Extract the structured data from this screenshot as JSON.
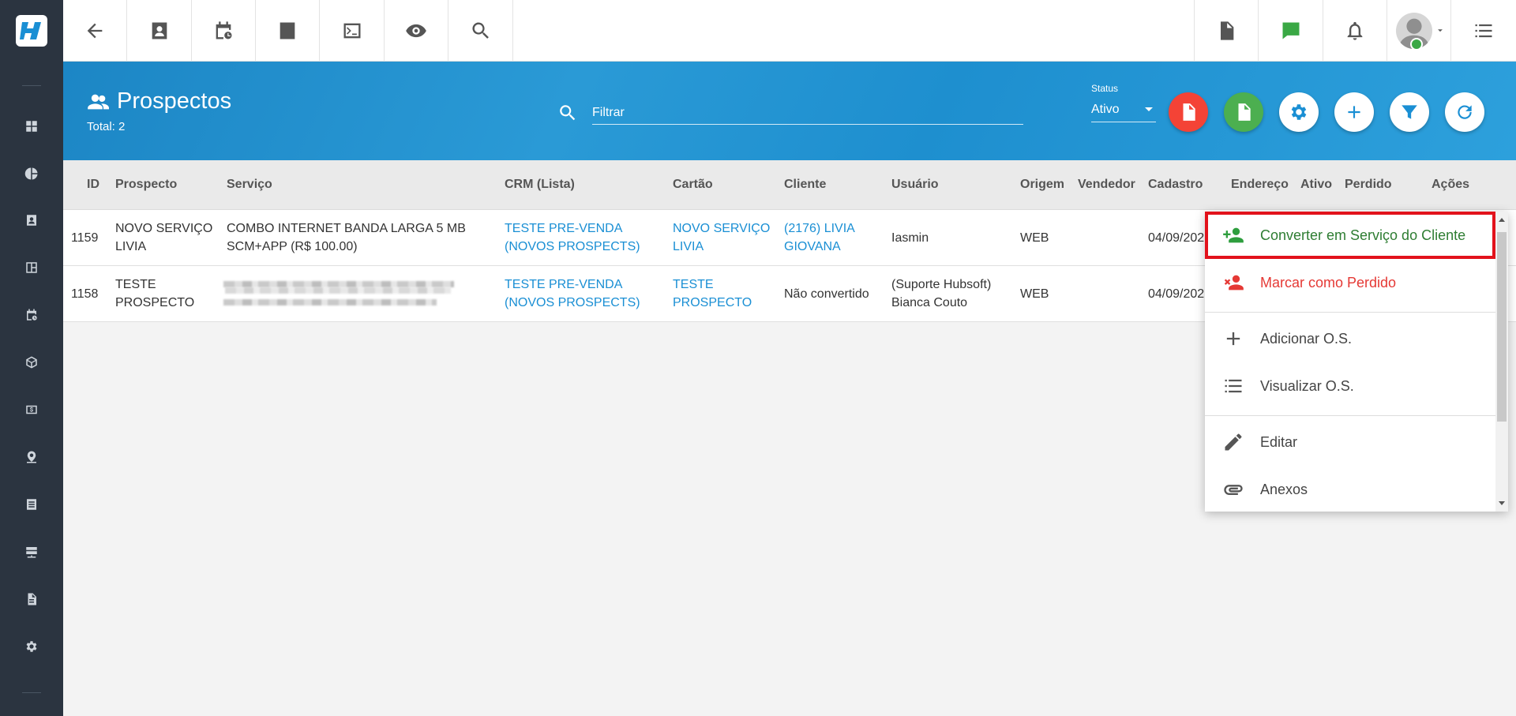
{
  "app": {
    "logo_letter": "H"
  },
  "topbar": {
    "left_icons": [
      "back-arrow-icon",
      "contact-card-icon",
      "calendar-clock-icon",
      "dollar-icon",
      "terminal-icon",
      "eye-icon",
      "search-icon"
    ],
    "right_icons": [
      "pdf-file-icon",
      "check-chat-icon",
      "bell-icon",
      "user-avatar",
      "menu-list-icon"
    ]
  },
  "header": {
    "title": "Prospectos",
    "total": "Total: 2",
    "filter_placeholder": "Filtrar",
    "status_label": "Status",
    "status_value": "Ativo",
    "colors": {
      "pdf": "#f44336",
      "excel": "#4caf50",
      "primary": "#1a8fd4"
    }
  },
  "table": {
    "columns": [
      "ID",
      "Prospecto",
      "Serviço",
      "CRM (Lista)",
      "Cartão",
      "Cliente",
      "Usuário",
      "Origem",
      "Vendedor",
      "Cadastro",
      "Endereço",
      "Ativo",
      "Perdido",
      "Ações"
    ],
    "rows": [
      {
        "id": "1159",
        "prospecto": [
          "NOVO SERVIÇO",
          "LIVIA"
        ],
        "servico": [
          "COMBO INTERNET BANDA LARGA 5 MB",
          "SCM+APP (R$ 100.00)"
        ],
        "crm": [
          "TESTE PRE-VENDA",
          "(NOVOS PROSPECTS)"
        ],
        "cartao": [
          "NOVO SERVIÇO",
          "LIVIA"
        ],
        "cliente": [
          "(2176) LIVIA",
          "GIOVANA"
        ],
        "usuario": [
          "Iasmin"
        ],
        "origem": "WEB",
        "cadastro": "04/09/202"
      },
      {
        "id": "1158",
        "prospecto": [
          "TESTE",
          "PROSPECTO"
        ],
        "servico": [],
        "crm": [
          "TESTE PRE-VENDA",
          "(NOVOS PROSPECTS)"
        ],
        "cartao": [
          "TESTE",
          "PROSPECTO"
        ],
        "cliente": [
          "Não convertido"
        ],
        "usuario": [
          "(Suporte Hubsoft)",
          "Bianca Couto"
        ],
        "origem": "WEB",
        "cadastro": "04/09/202"
      }
    ]
  },
  "menu": {
    "items": [
      {
        "label": "Converter em Serviço do Cliente",
        "icon": "person-add-icon",
        "color": "#2e7d32"
      },
      {
        "label": "Marcar como Perdido",
        "icon": "person-remove-icon",
        "color": "#e53935"
      },
      {
        "label": "Adicionar O.S.",
        "icon": "plus-icon",
        "color": "#444444"
      },
      {
        "label": "Visualizar O.S.",
        "icon": "list-icon",
        "color": "#444444"
      },
      {
        "label": "Editar",
        "icon": "pencil-icon",
        "color": "#444444"
      },
      {
        "label": "Anexos",
        "icon": "paperclip-icon",
        "color": "#444444"
      }
    ]
  }
}
